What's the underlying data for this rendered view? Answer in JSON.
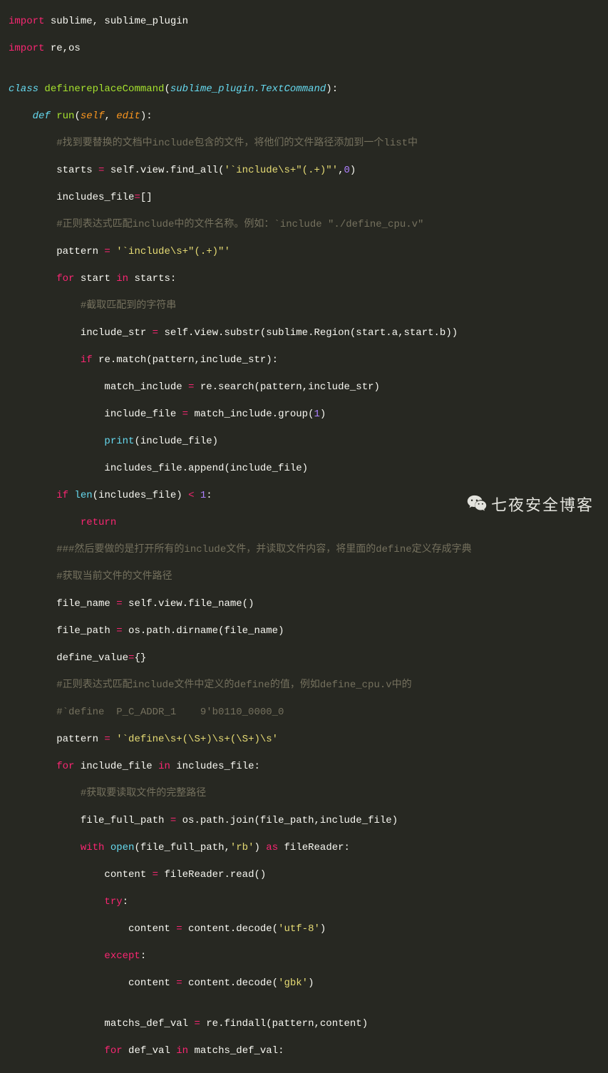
{
  "watermark": "七夜安全博客",
  "code": {
    "l0a": "import",
    "l0b": " sublime, sublime_plugin",
    "l1a": "import",
    "l1b": " re,os",
    "l2": "",
    "l3a": "class",
    "l3b": " ",
    "l3c": "definereplaceCommand",
    "l3d": "(",
    "l3e": "sublime_plugin.TextCommand",
    "l3f": "):",
    "l4a": "    ",
    "l4b": "def",
    "l4c": " ",
    "l4d": "run",
    "l4e": "(",
    "l4f": "self",
    "l4g": ", ",
    "l4h": "edit",
    "l4i": "):",
    "l5": "        #找到要替换的文档中include包含的文件，将他们的文件路径添加到一个list中",
    "l6a": "        starts ",
    "l6b": "=",
    "l6c": " self.view.find_all(",
    "l6d": "'`include\\s+\"(.+)\"'",
    "l6e": ",",
    "l6f": "0",
    "l6g": ")",
    "l7a": "        includes_file",
    "l7b": "=",
    "l7c": "[]",
    "l8": "        #正则表达式匹配include中的文件名称。例如：`include \"./define_cpu.v\"",
    "l9a": "        pattern ",
    "l9b": "=",
    "l9c": " ",
    "l9d": "'`include\\s+\"(.+)\"'",
    "l10a": "        ",
    "l10b": "for",
    "l10c": " start ",
    "l10d": "in",
    "l10e": " starts:",
    "l11": "            #截取匹配到的字符串",
    "l12a": "            include_str ",
    "l12b": "=",
    "l12c": " self.view.substr(sublime.Region(start.a,start.b))",
    "l13a": "            ",
    "l13b": "if",
    "l13c": " re.match(pattern,include_str):",
    "l14a": "                match_include ",
    "l14b": "=",
    "l14c": " re.search(pattern,include_str)",
    "l15a": "                include_file ",
    "l15b": "=",
    "l15c": " match_include.group(",
    "l15d": "1",
    "l15e": ")",
    "l16a": "                ",
    "l16b": "print",
    "l16c": "(include_file)",
    "l17": "                includes_file.append(include_file)",
    "l18a": "        ",
    "l18b": "if",
    "l18c": " ",
    "l18d": "len",
    "l18e": "(includes_file) ",
    "l18f": "<",
    "l18g": " ",
    "l18h": "1",
    "l18i": ":",
    "l19a": "            ",
    "l19b": "return",
    "l20": "        ###然后要做的是打开所有的include文件，并读取文件内容，将里面的define定义存成字典",
    "l21": "        #获取当前文件的文件路径",
    "l22a": "        file_name ",
    "l22b": "=",
    "l22c": " self.view.file_name()",
    "l23a": "        file_path ",
    "l23b": "=",
    "l23c": " os.path.dirname(file_name)",
    "l24a": "        define_value",
    "l24b": "=",
    "l24c": "{}",
    "l25": "        #正则表达式匹配include文件中定义的define的值，例如define_cpu.v中的",
    "l26": "        #`define  P_C_ADDR_1    9'b0110_0000_0",
    "l27a": "        pattern ",
    "l27b": "=",
    "l27c": " ",
    "l27d": "'`define\\s+(\\S+)\\s+(\\S+)\\s'",
    "l28a": "        ",
    "l28b": "for",
    "l28c": " include_file ",
    "l28d": "in",
    "l28e": " includes_file:",
    "l29": "            #获取要读取文件的完整路径",
    "l30a": "            file_full_path ",
    "l30b": "=",
    "l30c": " os.path.join(file_path,include_file)",
    "l31a": "            ",
    "l31b": "with",
    "l31c": " ",
    "l31d": "open",
    "l31e": "(file_full_path,",
    "l31f": "'rb'",
    "l31g": ") ",
    "l31h": "as",
    "l31i": " fileReader:",
    "l32a": "                content ",
    "l32b": "=",
    "l32c": " fileReader.read()",
    "l33a": "                ",
    "l33b": "try",
    "l33c": ":",
    "l34a": "                    content ",
    "l34b": "=",
    "l34c": " content.decode(",
    "l34d": "'utf-8'",
    "l34e": ")",
    "l35a": "                ",
    "l35b": "except",
    "l35c": ":",
    "l36a": "                    content ",
    "l36b": "=",
    "l36c": " content.decode(",
    "l36d": "'gbk'",
    "l36e": ")",
    "l37": "",
    "l38a": "                matchs_def_val ",
    "l38b": "=",
    "l38c": " re.findall(pattern,content)",
    "l39a": "                ",
    "l39b": "for",
    "l39c": " def_val ",
    "l39d": "in",
    "l39e": " matchs_def_val:"
  }
}
